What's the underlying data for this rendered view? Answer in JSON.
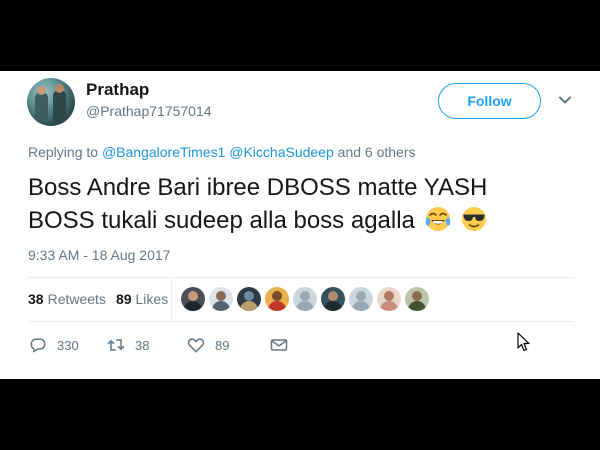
{
  "tweet": {
    "author": {
      "name": "Prathap",
      "handle": "@Prathap71757014"
    },
    "follow_label": "Follow",
    "reply_prefix": "Replying to",
    "reply_mention_1": "@BangaloreTimes1",
    "reply_mention_2": "@KicchaSudeep",
    "reply_suffix": "and 6 others",
    "text_line_1": "Boss Andre Bari ibree DBOSS matte YASH",
    "text_line_2": "BOSS tukali sudeep alla boss agalla",
    "emojis": [
      "face-with-tears-of-joy",
      "smiling-face-with-sunglasses"
    ],
    "timestamp": "9:33 AM - 18 Aug 2017",
    "retweets_count": "38",
    "retweets_label": "Retweets",
    "likes_count": "89",
    "likes_label": "Likes",
    "actions": {
      "reply_count": "330",
      "retweet_count": "38",
      "like_count": "89"
    }
  },
  "colors": {
    "accent": "#1da1f2",
    "link": "#1b95e0",
    "muted": "#657786",
    "text": "#14171a",
    "divider": "#e6ecf0"
  }
}
